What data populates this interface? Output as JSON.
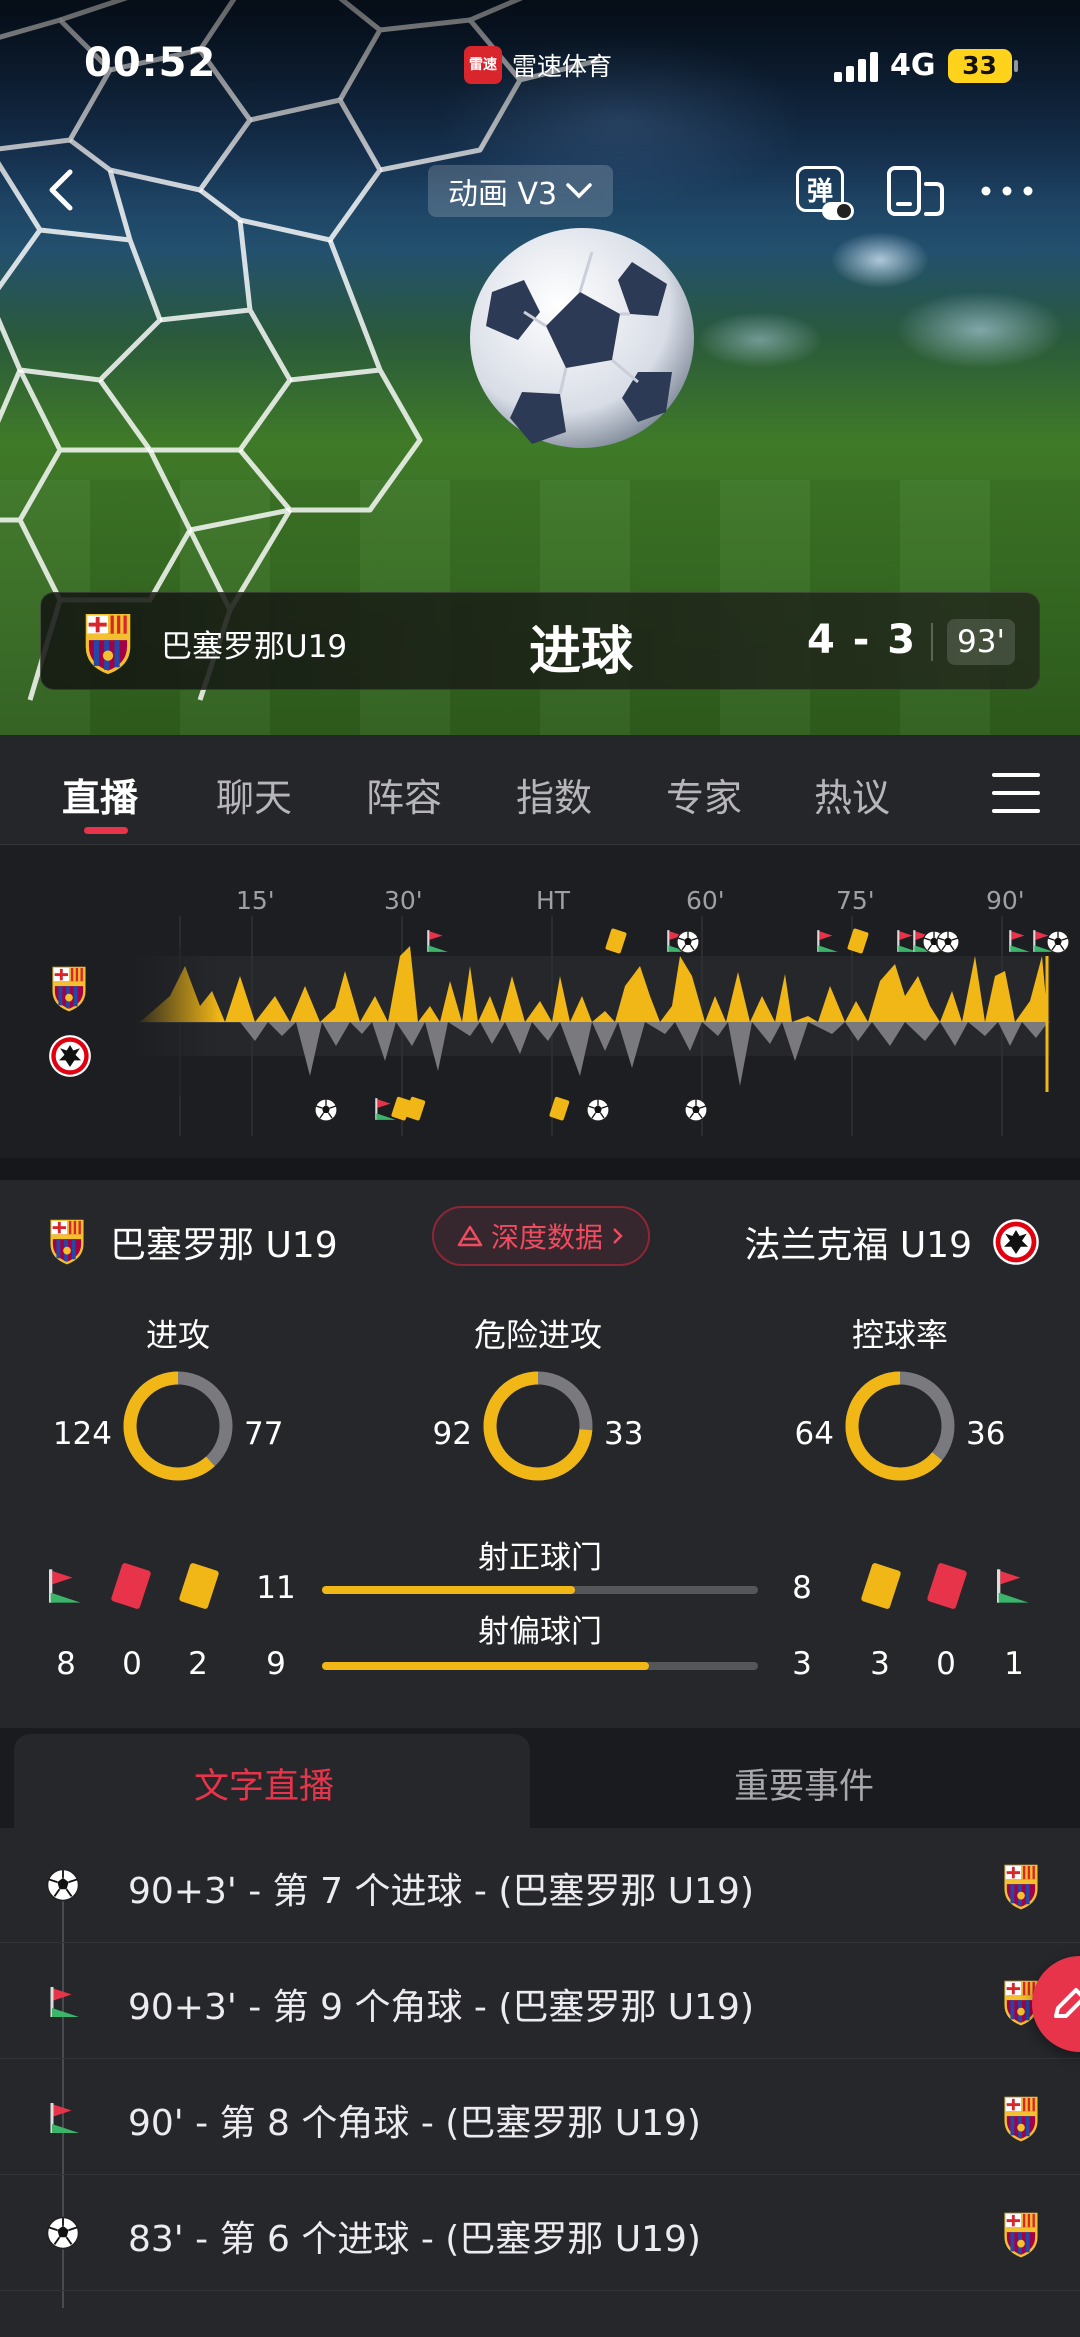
{
  "status_bar": {
    "time": "00:52",
    "app_logo_text": "雷速",
    "app_name": "雷速体育",
    "network": "4G",
    "battery": "33"
  },
  "nav": {
    "animation_label": "动画 V3",
    "danmu_label": "弹"
  },
  "goal_banner": {
    "team": "巴塞罗那U19",
    "event": "进球",
    "score": "4 - 3",
    "minute": "93'"
  },
  "tabs": [
    "直播",
    "聊天",
    "阵容",
    "指数",
    "专家",
    "热议"
  ],
  "timeline": {
    "ticks": [
      "15'",
      "30'",
      "HT",
      "60'",
      "75'",
      "90'"
    ]
  },
  "stats": {
    "home_team": "巴塞罗那 U19",
    "away_team": "法兰克福 U19",
    "deep_data_label": "深度数据",
    "rings": [
      {
        "title": "进攻",
        "home": "124",
        "away": "77",
        "home_ratio": 0.617
      },
      {
        "title": "危险进攻",
        "home": "92",
        "away": "33",
        "home_ratio": 0.736
      },
      {
        "title": "控球率",
        "home": "64",
        "away": "36",
        "home_ratio": 0.64
      }
    ],
    "bars": [
      {
        "label": "射正球门",
        "home": "11",
        "away": "8",
        "home_ratio": 0.58
      },
      {
        "label": "射偏球门",
        "home": "9",
        "away": "3",
        "home_ratio": 0.75
      }
    ],
    "home_counts": {
      "corners": "8",
      "red_cards": "0",
      "yellow_cards": "2"
    },
    "away_counts": {
      "yellow_cards": "3",
      "red_cards": "0",
      "corners": "1"
    }
  },
  "sub_tabs": {
    "active": "文字直播",
    "inactive": "重要事件"
  },
  "events": [
    {
      "icon": "ball-icon",
      "text": "90+3' - 第 7 个进球 - (巴塞罗那 U19)"
    },
    {
      "icon": "corner-flag-icon",
      "text": "90+3' - 第 9 个角球 - (巴塞罗那 U19)"
    },
    {
      "icon": "corner-flag-icon",
      "text": "90' - 第 8 个角球 - (巴塞罗那 U19)"
    },
    {
      "icon": "ball-icon",
      "text": "83' - 第 6 个进球 - (巴塞罗那 U19)"
    }
  ],
  "colors": {
    "accent": "#e8344b",
    "home_bar": "#f1b716",
    "away_bar": "#7a7a7e",
    "background": "#26272b"
  }
}
